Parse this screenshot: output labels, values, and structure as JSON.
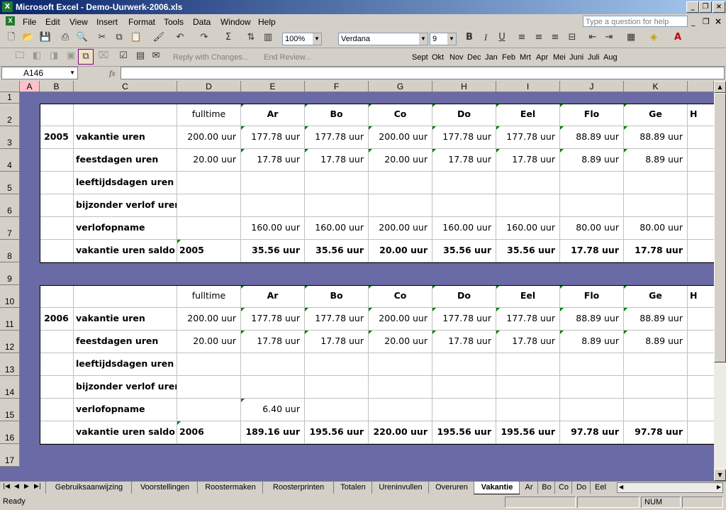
{
  "window": {
    "title": "Microsoft Excel - Demo-Uurwerk-2006.xls",
    "app_icon": "excel-icon"
  },
  "menu": [
    "File",
    "Edit",
    "View",
    "Insert",
    "Format",
    "Tools",
    "Data",
    "Window",
    "Help"
  ],
  "help_placeholder": "Type a question for help",
  "toolbar": {
    "zoom": "100%",
    "font": "Verdana",
    "size": "9",
    "reply_label": "Reply with Changes...",
    "end_review_label": "End Review...",
    "months": [
      "Sept",
      "Okt",
      "Nov",
      "Dec",
      "Jan",
      "Feb",
      "Mrt",
      "Apr",
      "Mei",
      "Juni",
      "Juli",
      "Aug"
    ]
  },
  "formula_bar": {
    "name_box": "A146",
    "fx": "fx",
    "formula": ""
  },
  "columns": [
    "A",
    "B",
    "C",
    "D",
    "E",
    "F",
    "G",
    "H",
    "I",
    "J",
    "K"
  ],
  "rows": [
    "1",
    "2",
    "3",
    "4",
    "5",
    "6",
    "7",
    "8",
    "9",
    "10",
    "11",
    "12",
    "13",
    "14",
    "15",
    "16",
    "17"
  ],
  "grid": {
    "header": [
      "fulltime",
      "Ar",
      "Bo",
      "Co",
      "Do",
      "Eel",
      "Flo",
      "Ge",
      "H"
    ],
    "labels": [
      "vakantie uren",
      "feestdagen uren",
      "leeftijdsdagen uren",
      "bijzonder verlof uren",
      "verlofopname",
      "vakantie uren saldo"
    ],
    "block2005": {
      "year": "2005",
      "rows": [
        [
          "200.00 uur",
          "177.78 uur",
          "177.78 uur",
          "200.00 uur",
          "177.78 uur",
          "177.78 uur",
          "88.89 uur",
          "88.89 uur"
        ],
        [
          "20.00 uur",
          "17.78 uur",
          "17.78 uur",
          "20.00 uur",
          "17.78 uur",
          "17.78 uur",
          "8.89 uur",
          "8.89 uur"
        ],
        [
          "",
          "",
          "",
          "",
          "",
          "",
          "",
          ""
        ],
        [
          "",
          "",
          "",
          "",
          "",
          "",
          "",
          ""
        ],
        [
          "",
          "160.00 uur",
          "160.00 uur",
          "200.00 uur",
          "160.00 uur",
          "160.00 uur",
          "80.00 uur",
          "80.00 uur"
        ],
        [
          "2005",
          "35.56 uur",
          "35.56 uur",
          "20.00 uur",
          "35.56 uur",
          "35.56 uur",
          "17.78 uur",
          "17.78 uur"
        ]
      ]
    },
    "block2006": {
      "year": "2006",
      "rows": [
        [
          "200.00 uur",
          "177.78 uur",
          "177.78 uur",
          "200.00 uur",
          "177.78 uur",
          "177.78 uur",
          "88.89 uur",
          "88.89 uur"
        ],
        [
          "20.00 uur",
          "17.78 uur",
          "17.78 uur",
          "20.00 uur",
          "17.78 uur",
          "17.78 uur",
          "8.89 uur",
          "8.89 uur"
        ],
        [
          "",
          "",
          "",
          "",
          "",
          "",
          "",
          ""
        ],
        [
          "",
          "",
          "",
          "",
          "",
          "",
          "",
          ""
        ],
        [
          "",
          "6.40 uur",
          "",
          "",
          "",
          "",
          "",
          ""
        ],
        [
          "2006",
          "189.16 uur",
          "195.56 uur",
          "220.00 uur",
          "195.56 uur",
          "195.56 uur",
          "97.78 uur",
          "97.78 uur"
        ]
      ]
    }
  },
  "tabs": [
    "Gebruiksaanwijzing",
    "Voorstellingen",
    "Roostermaken",
    "Roosterprinten",
    "Totalen",
    "Ureninvullen",
    "Overuren",
    "Vakantie",
    "Ar",
    "Bo",
    "Co",
    "Do",
    "Eel"
  ],
  "active_tab": "Vakantie",
  "status": {
    "left": "Ready",
    "num": "NUM"
  }
}
